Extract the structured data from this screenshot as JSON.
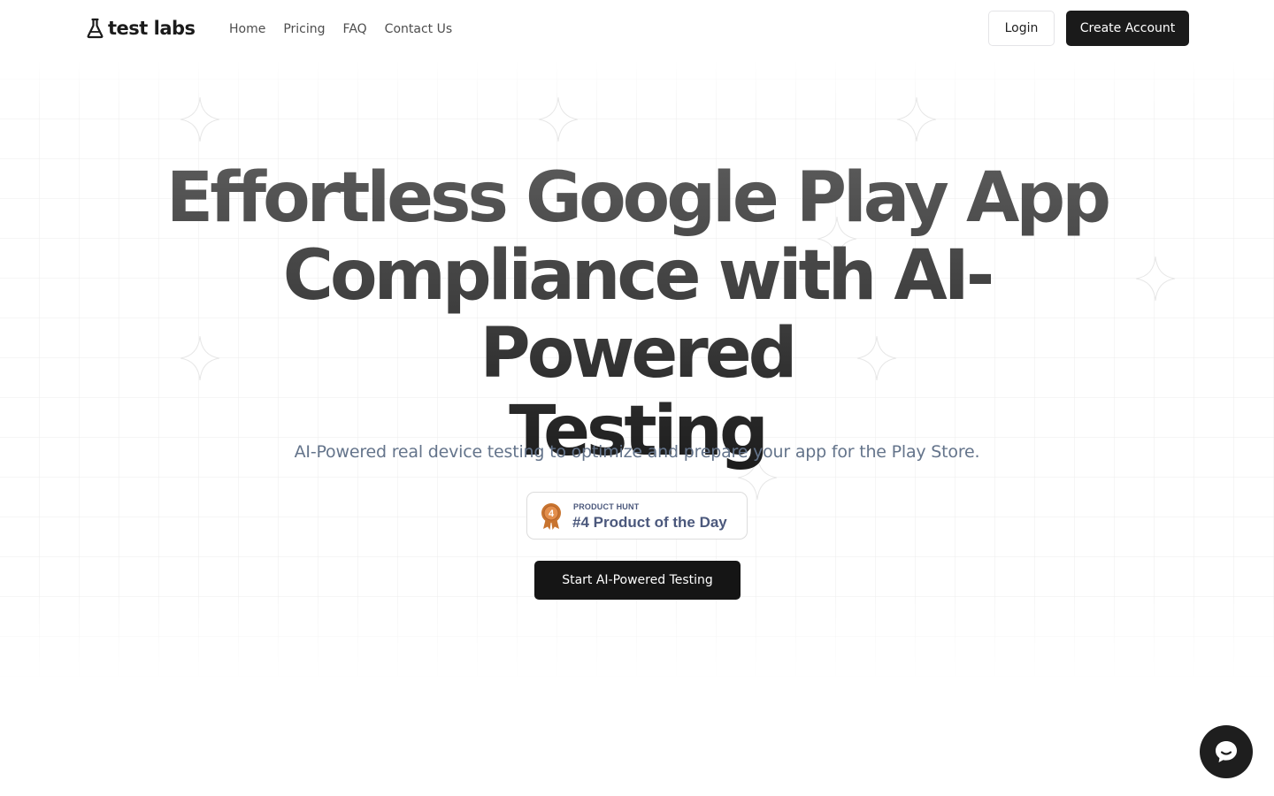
{
  "nav": {
    "logo_text": "test labs",
    "logo_icon": "flask-icon",
    "links": [
      "Home",
      "Pricing",
      "FAQ",
      "Contact Us"
    ],
    "login_label": "Login",
    "create_label": "Create Account"
  },
  "hero": {
    "title_line1": "Effortless Google Play App",
    "title_line2": "Compliance with AI-Powered",
    "title_line3": "Testing",
    "subtitle": "AI-Powered real device testing to optimize and prepare your app for the Play Store."
  },
  "badge": {
    "label": "PRODUCT HUNT",
    "title": "#4 Product of the Day",
    "medal_number": "4",
    "medal_icon": "medal-icon"
  },
  "cta": {
    "label": "Start AI-Powered Testing"
  },
  "chat": {
    "icon": "chat-bubble-icon"
  },
  "colors": {
    "primary_dark": "#1a1a1a",
    "subtitle": "#64748b",
    "badge_text": "#4b587c",
    "medal": "#c8742f"
  }
}
